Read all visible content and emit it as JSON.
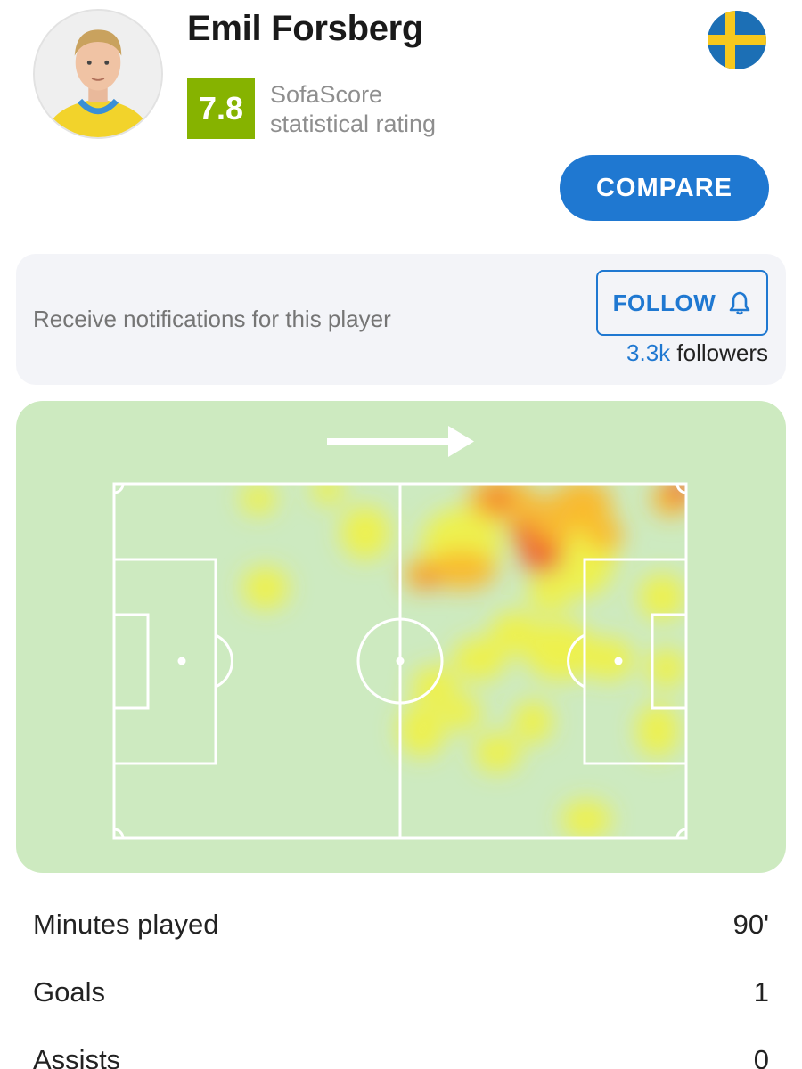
{
  "player": {
    "name": "Emil Forsberg",
    "avatar_icon": "player-photo",
    "flag_icon": "sweden-flag"
  },
  "rating": {
    "value": "7.8",
    "caption_line1": "SofaScore",
    "caption_line2": "statistical rating",
    "color": "#86b300"
  },
  "actions": {
    "compare_label": "COMPARE",
    "accent": "#1f78d1"
  },
  "notifications": {
    "text": "Receive notifications for this player",
    "follow_label": "FOLLOW",
    "follow_icon": "bell-icon",
    "followers_count": "3.3k",
    "followers_suffix": " followers"
  },
  "heatmap": {
    "direction_icon": "arrow-right-icon",
    "pitch_color": "#cdeac0"
  },
  "stats": [
    {
      "label": "Minutes played",
      "value": "90'"
    },
    {
      "label": "Goals",
      "value": "1"
    },
    {
      "label": "Assists",
      "value": "0"
    }
  ]
}
